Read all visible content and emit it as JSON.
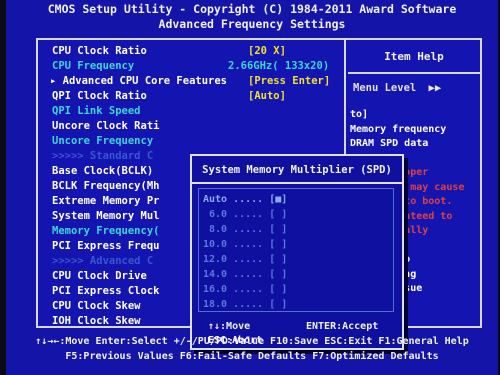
{
  "header": {
    "line1": "CMOS Setup Utility - Copyright (C) 1984-2011 Award Software",
    "line2": "Advanced Frequency Settings"
  },
  "items": [
    {
      "label": "CPU Clock Ratio",
      "value": "[20 X]"
    },
    {
      "label": "CPU Frequency",
      "value": "2.66GHz( 133x20)"
    },
    {
      "label": "▸ Advanced CPU Core Features",
      "value": "[Press Enter]"
    },
    {
      "label": "QPI Clock Ratio",
      "value": "[Auto]"
    },
    {
      "label": "QPI Link Speed"
    },
    {
      "label": "Uncore Clock Rati"
    },
    {
      "label": "Uncore Frequency"
    },
    {
      "label": ">>>>>  Standard C"
    },
    {
      "label": "Base Clock(BCLK)"
    },
    {
      "label": "BCLK Frequency(Mh"
    },
    {
      "label": "Extreme Memory Pr"
    },
    {
      "label": "System Memory Mul"
    },
    {
      "label": "Memory Frequency("
    },
    {
      "label": "PCI Express Frequ"
    },
    {
      "label": ">>>>>  Advanced C"
    },
    {
      "label": "CPU Clock Drive"
    },
    {
      "label": "PCI Express Clock"
    },
    {
      "label": "CPU Clock Skew"
    },
    {
      "label": "IOH Clock Skew"
    }
  ],
  "help": {
    "title": "Item Help",
    "menu_level": "Menu Level",
    "menu_arrows": "▶▶",
    "lines": [
      "to]",
      "Memory frequency",
      "DRAM SPD data",
      "",
      "ing: improper",
      "ory clock may cause",
      "tem fail to boot.",
      "not guaranteed to",
      "rate normally",
      "",
      "ar CMOS to",
      "rcome wrong",
      "quency issue"
    ]
  },
  "popup": {
    "title": "System Memory Multiplier (SPD)",
    "options": [
      "Auto ..... [■]",
      "6.0 ..... [ ]",
      "8.0 ..... [ ]",
      "10.0 ..... [ ]",
      "12.0 ..... [ ]",
      "14.0 ..... [ ]",
      "16.0 ..... [ ]",
      "18.0 ..... [ ]"
    ],
    "key_move": "↑↓:Move",
    "key_enter": "ENTER:Accept",
    "key_abort": "ESC:Abort"
  },
  "footer": {
    "line1": "↑↓→←:Move  Enter:Select  +/-/PU/PD:Value  F10:Save  ESC:Exit  F1:General Help",
    "line2": "F5:Previous Values  F6:Fail-Safe Defaults  F7:Optimized Defaults"
  }
}
